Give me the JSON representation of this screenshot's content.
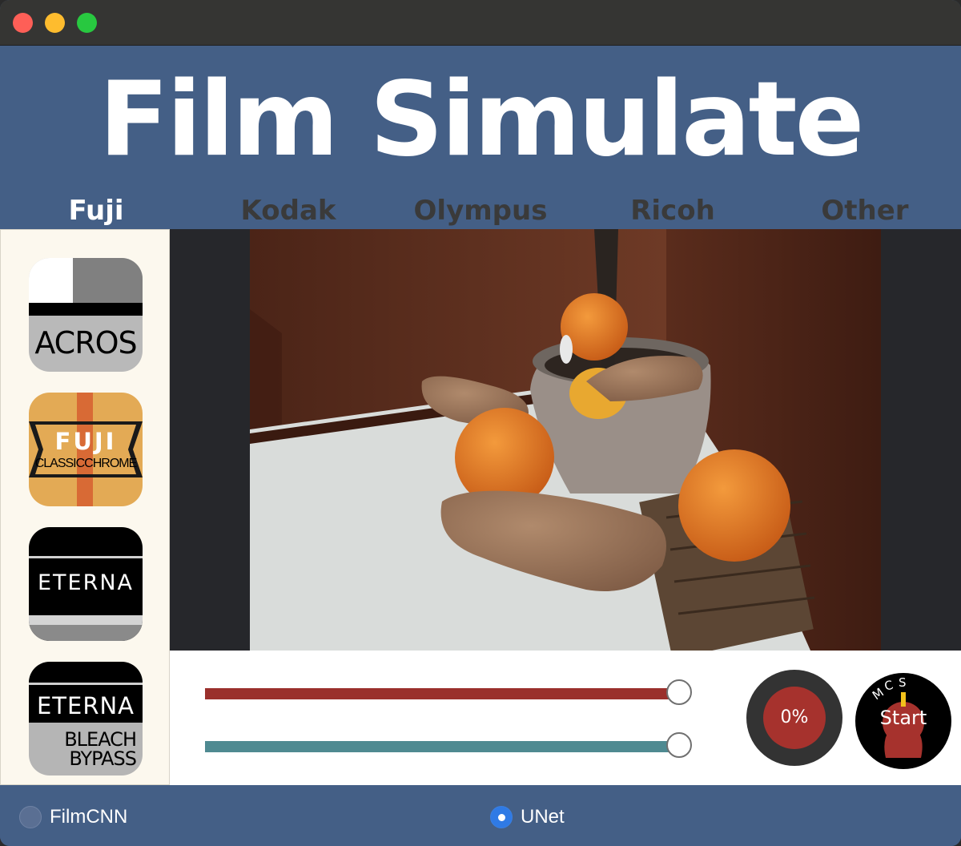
{
  "window": {
    "title_text": "Film Simulate"
  },
  "tabs": [
    {
      "label": "Fuji",
      "active": true
    },
    {
      "label": "Kodak",
      "active": false
    },
    {
      "label": "Olympus",
      "active": false
    },
    {
      "label": "Ricoh",
      "active": false
    },
    {
      "label": "Other",
      "active": false
    }
  ],
  "sidebar": {
    "films": [
      {
        "label": "ACROS"
      },
      {
        "label_top": "FUJI",
        "label_bottom": "CLASSICCHROME"
      },
      {
        "label": "ETERNA"
      },
      {
        "label_top": "ETERNA",
        "line1": "BLEACH",
        "line2": "BYPASS"
      }
    ]
  },
  "controls": {
    "slider1": {
      "value": 1.0,
      "color": "#9a302c"
    },
    "slider2": {
      "value": 1.0,
      "color": "#4f8a91"
    },
    "progress_text": "0%",
    "start_label": "Start",
    "dial_letters": [
      "M",
      "C",
      "S"
    ]
  },
  "bottom": {
    "options": [
      {
        "label": "FilmCNN",
        "selected": false
      },
      {
        "label": "UNet",
        "selected": true
      }
    ]
  },
  "colors": {
    "accent_blue": "#445f86",
    "sidebar_bg": "#fcf8ee",
    "preview_bg": "#26272b"
  }
}
